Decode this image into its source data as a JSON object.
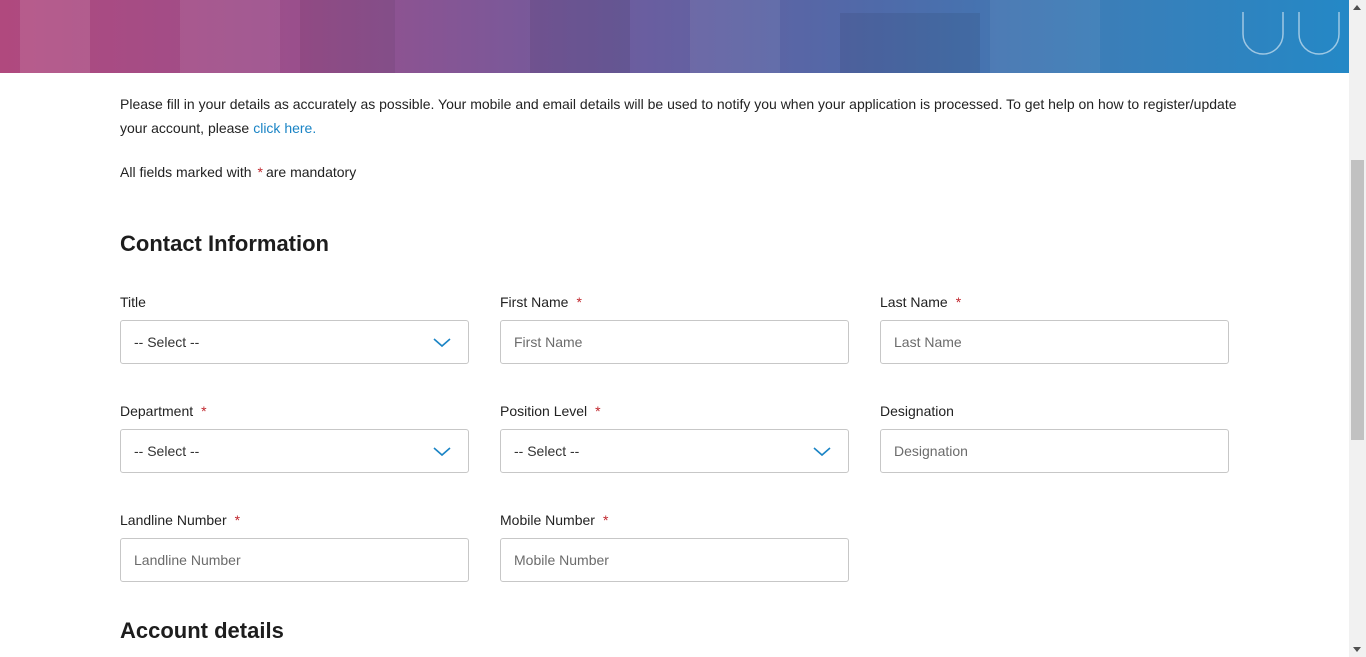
{
  "intro": {
    "text": "Please fill in your details as accurately as possible. Your mobile and email details will be used to notify you when your application is processed. To get help on how to register/update your account, please",
    "link": "click here."
  },
  "mandatory": {
    "prefix": "All fields marked with",
    "star": "*",
    "suffix": "are mandatory"
  },
  "contact": {
    "title": "Contact Information",
    "title_field": {
      "label": "Title",
      "selected": "-- Select --"
    },
    "first_name": {
      "label": "First Name",
      "required": "*",
      "placeholder": "First Name"
    },
    "last_name": {
      "label": "Last Name",
      "required": "*",
      "placeholder": "Last Name"
    },
    "department": {
      "label": "Department",
      "required": "*",
      "selected": "-- Select --"
    },
    "position_level": {
      "label": "Position Level",
      "required": "*",
      "selected": "-- Select --"
    },
    "designation": {
      "label": "Designation",
      "placeholder": "Designation"
    },
    "landline": {
      "label": "Landline Number",
      "required": "*",
      "placeholder": "Landline Number"
    },
    "mobile": {
      "label": "Mobile Number",
      "required": "*",
      "placeholder": "Mobile Number"
    }
  },
  "account": {
    "title": "Account details"
  },
  "colors": {
    "accent": "#1a84c5",
    "required": "#c0262d",
    "border": "#c7c7c7",
    "chevron": "#1a84c5"
  },
  "icons": {
    "dropdown": "chevron-down-icon",
    "logo": "brand-logo-icon"
  }
}
